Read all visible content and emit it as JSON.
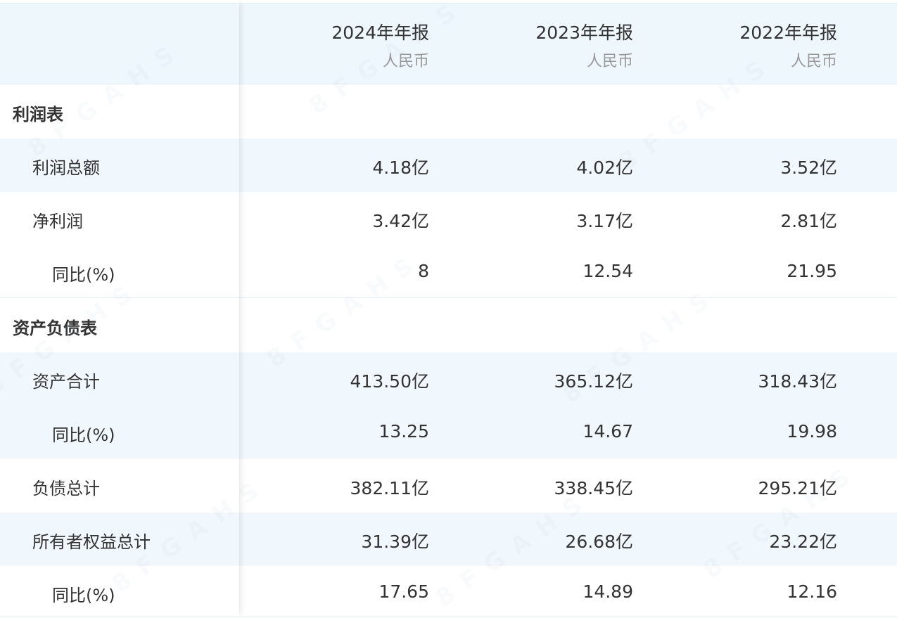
{
  "header": {
    "columns": [
      {
        "period": "2024年年报",
        "currency": "人民币"
      },
      {
        "period": "2023年年报",
        "currency": "人民币"
      },
      {
        "period": "2022年年报",
        "currency": "人民币"
      }
    ]
  },
  "sections": [
    {
      "title": "利润表",
      "rows": [
        {
          "label": "利润总额",
          "values": [
            "4.18亿",
            "4.02亿",
            "3.52亿"
          ]
        },
        {
          "label": "净利润",
          "values": [
            "3.42亿",
            "3.17亿",
            "2.81亿"
          ]
        },
        {
          "label": "同比(%)",
          "values": [
            "8",
            "12.54",
            "21.95"
          ]
        }
      ]
    },
    {
      "title": "资产负债表",
      "rows": [
        {
          "label": "资产合计",
          "values": [
            "413.50亿",
            "365.12亿",
            "318.43亿"
          ]
        },
        {
          "label": "同比(%)",
          "values": [
            "13.25",
            "14.67",
            "19.98"
          ]
        },
        {
          "label": "负债总计",
          "values": [
            "382.11亿",
            "338.45亿",
            "295.21亿"
          ]
        },
        {
          "label": "所有者权益总计",
          "values": [
            "31.39亿",
            "26.68亿",
            "23.22亿"
          ]
        },
        {
          "label": "同比(%)",
          "values": [
            "17.65",
            "14.89",
            "12.16"
          ]
        }
      ]
    }
  ],
  "watermark": "8FGAHS",
  "colors": {
    "header_bg": "#eef7fc",
    "alt_row_bg": "#f1f8fd",
    "text": "#333333",
    "muted": "#999999",
    "border": "#e2eef6"
  }
}
